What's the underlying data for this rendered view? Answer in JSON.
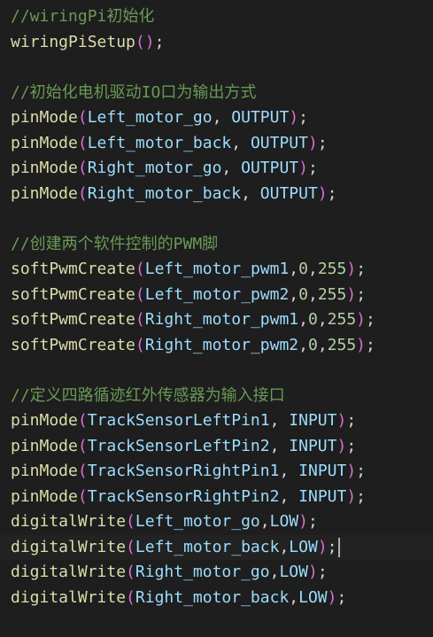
{
  "lines": [
    {
      "text": "//wiringPi初始化",
      "kind": "comment"
    },
    {
      "text": "wiringPiSetup();",
      "kind": "code"
    },
    {
      "text": "",
      "kind": "blank"
    },
    {
      "text": "//初始化电机驱动IO口为输出方式",
      "kind": "comment"
    },
    {
      "text": "pinMode(Left_motor_go, OUTPUT);",
      "kind": "code"
    },
    {
      "text": "pinMode(Left_motor_back, OUTPUT);",
      "kind": "code"
    },
    {
      "text": "pinMode(Right_motor_go, OUTPUT);",
      "kind": "code"
    },
    {
      "text": "pinMode(Right_motor_back, OUTPUT);",
      "kind": "code"
    },
    {
      "text": "",
      "kind": "blank"
    },
    {
      "text": "//创建两个软件控制的PWM脚",
      "kind": "comment"
    },
    {
      "text": "softPwmCreate(Left_motor_pwm1,0,255);",
      "kind": "code"
    },
    {
      "text": "softPwmCreate(Left_motor_pwm2,0,255);",
      "kind": "code"
    },
    {
      "text": "softPwmCreate(Right_motor_pwm1,0,255);",
      "kind": "code"
    },
    {
      "text": "softPwmCreate(Right_motor_pwm2,0,255);",
      "kind": "code"
    },
    {
      "text": "",
      "kind": "blank"
    },
    {
      "text": "//定义四路循迹红外传感器为输入接口",
      "kind": "comment"
    },
    {
      "text": "pinMode(TrackSensorLeftPin1, INPUT);",
      "kind": "code"
    },
    {
      "text": "pinMode(TrackSensorLeftPin2, INPUT);",
      "kind": "code"
    },
    {
      "text": "pinMode(TrackSensorRightPin1, INPUT);",
      "kind": "code"
    },
    {
      "text": "pinMode(TrackSensorRightPin2, INPUT);",
      "kind": "code"
    },
    {
      "text": "digitalWrite(Left_motor_go,LOW);",
      "kind": "code"
    },
    {
      "text": "digitalWrite(Left_motor_back,LOW);",
      "kind": "code"
    },
    {
      "text": "digitalWrite(Right_motor_go,LOW);",
      "kind": "code"
    },
    {
      "text": "digitalWrite(Right_motor_back,LOW);",
      "kind": "code"
    }
  ],
  "cursor_line": 21,
  "colors": {
    "background": "#1e1e1e",
    "comment": "#6a9955",
    "function": "#dcdcaa",
    "bracket_level1": "#da70d6",
    "bracket_level2": "#179fff",
    "identifier": "#9cdcfe",
    "number": "#b5cea8",
    "punctuation": "#d4d4d4"
  }
}
